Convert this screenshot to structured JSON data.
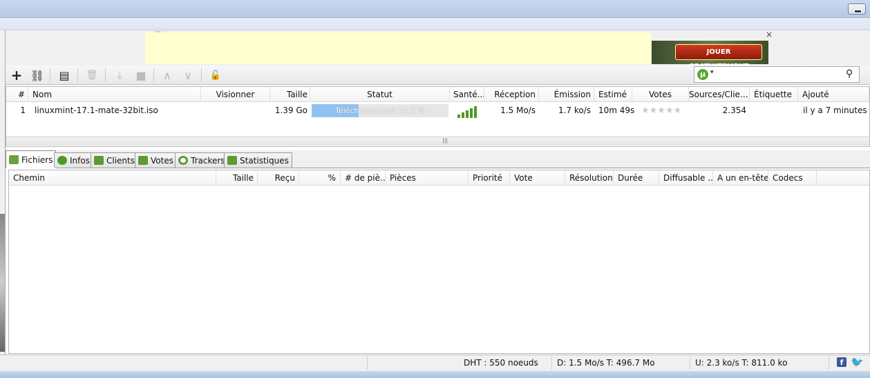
{
  "ad": {
    "dots": "···",
    "button_label": "JOUER GRATUITEMENT",
    "close_label": "×"
  },
  "toolbar": {
    "add_icon": "+",
    "link_icon": "⛓",
    "file_icon": "▤",
    "delete_icon": "🗑",
    "download_icon": "⤓",
    "stop_icon": "■",
    "up_icon": "∧",
    "down_icon": "∨",
    "unlock_icon": "🔓"
  },
  "search": {
    "logo": "µ",
    "caret": "▾",
    "value": "",
    "glass": "⚲"
  },
  "torrent_columns": [
    "#",
    "Nom",
    "Visionner",
    "Taille",
    "Statut",
    "Santé...",
    "Réception",
    "Émission",
    "Estimé",
    "Votes",
    "Sources/Clie...",
    "Étiquette",
    "Ajouté"
  ],
  "torrent": {
    "index": "1",
    "name": "linuxmint-17.1-mate-32bit.iso",
    "size": "1.39 Go",
    "status": "Téléchargement 34.5 %",
    "progress_pct": 34.5,
    "health_bars": 5,
    "download_speed": "1.5 Mo/s",
    "upload_speed": "1.7 ko/s",
    "eta": "10m 49s",
    "votes": "★★★★★",
    "sources": "2.354",
    "label": "",
    "added": "il y a 7 minutes"
  },
  "scroll_grip": "|||",
  "tabs": [
    "Fichiers",
    "Infos",
    "Clients",
    "Votes",
    "Trackers",
    "Statistiques"
  ],
  "file_columns": [
    "Chemin",
    "Taille",
    "Reçu",
    "%",
    "# de piè...",
    "Pièces",
    "Priorité",
    "Vote",
    "Résolution",
    "Durée",
    "Diffusable ...",
    "A un en-tête",
    "Codecs"
  ],
  "status": {
    "dht": "DHT : 550 noeuds",
    "down": "D: 1.5 Mo/s T: 496.7 Mo",
    "up": "U: 2.3 ko/s T: 811.0 ko",
    "facebook": "f",
    "twitter": "🐦"
  },
  "colors": {
    "progress_fill": "#8fc2f2",
    "health": "#4e9a24",
    "accent_green": "#5aa832"
  }
}
